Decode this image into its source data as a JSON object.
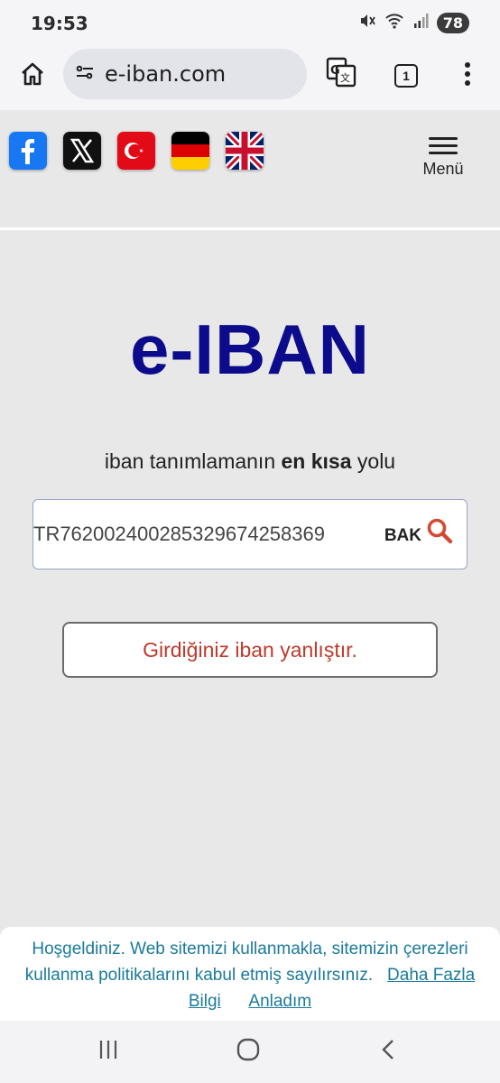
{
  "status_bar": {
    "time": "19:53",
    "battery": "78",
    "icons": [
      "mute-icon",
      "wifi-icon",
      "signal-icon"
    ]
  },
  "browser": {
    "url": "e-iban.com",
    "tab_count": "1",
    "icons": [
      "home-icon",
      "site-settings-icon",
      "translate-icon",
      "tabs-icon",
      "more-vert-icon"
    ]
  },
  "header": {
    "social": [
      "facebook",
      "x-twitter",
      "turkish-flag",
      "german-flag",
      "uk-flag"
    ],
    "menu_label": "Menü"
  },
  "main": {
    "logo": "e-IBAN",
    "tagline_prefix": "iban tanımlamanın ",
    "tagline_bold": "en kısa",
    "tagline_suffix": " yolu",
    "search_value": "TR762002400285329674258369",
    "search_button": "BAK",
    "error_message": "Girdiğiniz iban yanlıştır."
  },
  "cookie_banner": {
    "text": "Hoşgeldiniz. Web sitemizi kullanmakla, sitemizin çerezleri kullanma politikalarını kabul etmiş sayılırsınız.",
    "more_link": "Daha Fazla Bilgi",
    "accept_link": "Anladım"
  },
  "colors": {
    "logo": "#0b0b8c",
    "error": "#c0392b",
    "cookie_link": "#1a7a9a",
    "page_bg": "#e8e8e8"
  }
}
